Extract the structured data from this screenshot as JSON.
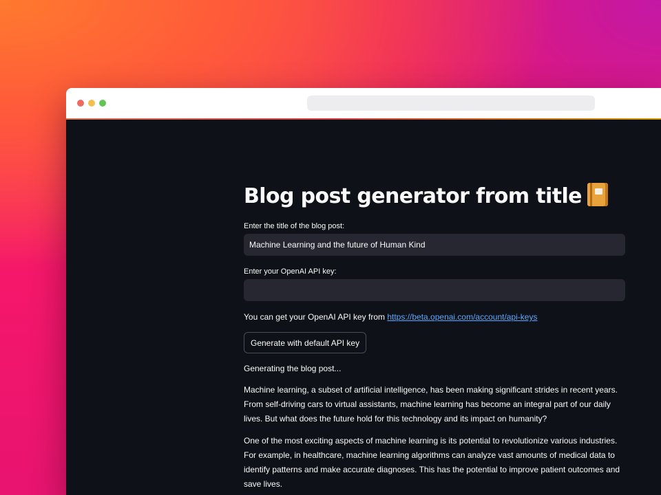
{
  "app": {
    "title": "Blog post generator from title",
    "title_icon": "book-emoji-icon"
  },
  "form": {
    "title_label": "Enter the title of the blog post:",
    "title_value": "Machine Learning and the future of Human Kind",
    "api_key_label": "Enter your OpenAI API key:",
    "api_key_value": "",
    "api_info_prefix": "You can get your OpenAI API key from ",
    "api_info_link": "https://beta.openai.com/account/api-keys",
    "generate_button_label": "Generate with default API key"
  },
  "output": {
    "status": "Generating the blog post...",
    "paragraphs": [
      "Machine learning, a subset of artificial intelligence, has been making significant strides in recent years. From self-driving cars to virtual assistants, machine learning has become an integral part of our daily lives. But what does the future hold for this technology and its impact on humanity?",
      "One of the most exciting aspects of machine learning is its potential to revolutionize various industries. For example, in healthcare, machine learning algorithms can analyze vast amounts of medical data to identify patterns and make accurate diagnoses. This has the potential to improve patient outcomes and save lives."
    ]
  },
  "colors": {
    "background": "#0e1117",
    "input_background": "#262730",
    "text": "#fafafa",
    "link": "#5da8ff"
  }
}
